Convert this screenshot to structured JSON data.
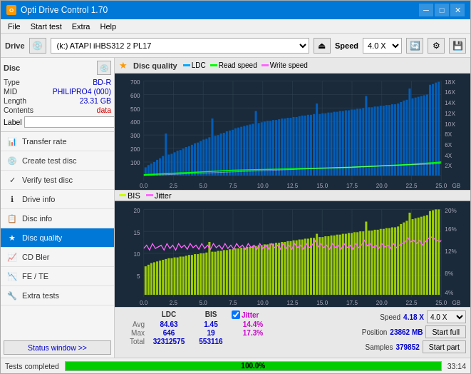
{
  "window": {
    "title": "Opti Drive Control 1.70",
    "icon": "O"
  },
  "titlebar": {
    "minimize": "─",
    "maximize": "□",
    "close": "✕"
  },
  "menu": {
    "items": [
      "File",
      "Start test",
      "Extra",
      "Help"
    ]
  },
  "toolbar": {
    "drive_label": "Drive",
    "drive_value": "(k:) ATAPI iHBS312  2 PL17",
    "speed_label": "Speed",
    "speed_value": "4.0 X"
  },
  "disc": {
    "title": "Disc",
    "type_label": "Type",
    "type_value": "BD-R",
    "mid_label": "MID",
    "mid_value": "PHILIPRO4 (000)",
    "length_label": "Length",
    "length_value": "23.31 GB",
    "contents_label": "Contents",
    "contents_value": "data",
    "label_label": "Label",
    "label_placeholder": ""
  },
  "nav": {
    "items": [
      {
        "id": "transfer-rate",
        "label": "Transfer rate",
        "icon": "📊"
      },
      {
        "id": "create-test-disc",
        "label": "Create test disc",
        "icon": "💿"
      },
      {
        "id": "verify-test-disc",
        "label": "Verify test disc",
        "icon": "✓"
      },
      {
        "id": "drive-info",
        "label": "Drive info",
        "icon": "ℹ"
      },
      {
        "id": "disc-info",
        "label": "Disc info",
        "icon": "📋"
      },
      {
        "id": "disc-quality",
        "label": "Disc quality",
        "icon": "★",
        "active": true
      },
      {
        "id": "cd-bler",
        "label": "CD Bler",
        "icon": "📈"
      },
      {
        "id": "fe-te",
        "label": "FE / TE",
        "icon": "📉"
      },
      {
        "id": "extra-tests",
        "label": "Extra tests",
        "icon": "🔧"
      }
    ],
    "status_window": "Status window >>"
  },
  "chart": {
    "title": "Disc quality",
    "icon": "★",
    "legend": {
      "ldc_label": "LDC",
      "ldc_color": "#00aaff",
      "read_label": "Read speed",
      "read_color": "#00ff00",
      "write_label": "Write speed",
      "write_color": "#ff66ff"
    },
    "legend2": {
      "bis_label": "BIS",
      "bis_color": "#ccff00",
      "jitter_label": "Jitter",
      "jitter_color": "#ff66ff"
    },
    "x_labels": [
      "0.0",
      "2.5",
      "5.0",
      "7.5",
      "10.0",
      "12.5",
      "15.0",
      "17.5",
      "20.0",
      "22.5",
      "25.0"
    ],
    "y_labels_top": [
      "700",
      "600",
      "500",
      "400",
      "300",
      "200",
      "100"
    ],
    "y_labels_right_top": [
      "18X",
      "16X",
      "14X",
      "12X",
      "10X",
      "8X",
      "6X",
      "4X",
      "2X"
    ],
    "y_labels_bottom": [
      "20",
      "15",
      "10",
      "5"
    ],
    "y_labels_right_bottom": [
      "20%",
      "16%",
      "12%",
      "8%",
      "4%"
    ]
  },
  "stats": {
    "col_ldc": "LDC",
    "col_bis": "BIS",
    "col_jitter": "Jitter",
    "col_speed": "Speed",
    "avg_label": "Avg",
    "avg_ldc": "84.63",
    "avg_bis": "1.45",
    "avg_jitter": "14.4%",
    "max_label": "Max",
    "max_ldc": "646",
    "max_bis": "19",
    "max_jitter": "17.3%",
    "total_label": "Total",
    "total_ldc": "32312575",
    "total_bis": "553116",
    "speed_label": "Speed",
    "speed_value": "4.18 X",
    "speed_select": "4.0 X",
    "position_label": "Position",
    "position_value": "23862 MB",
    "samples_label": "Samples",
    "samples_value": "379852",
    "jitter_checked": true,
    "start_full_label": "Start full",
    "start_part_label": "Start part"
  },
  "statusbar": {
    "text": "Tests completed",
    "progress": 100,
    "progress_text": "100.0%",
    "time": "33:14"
  }
}
